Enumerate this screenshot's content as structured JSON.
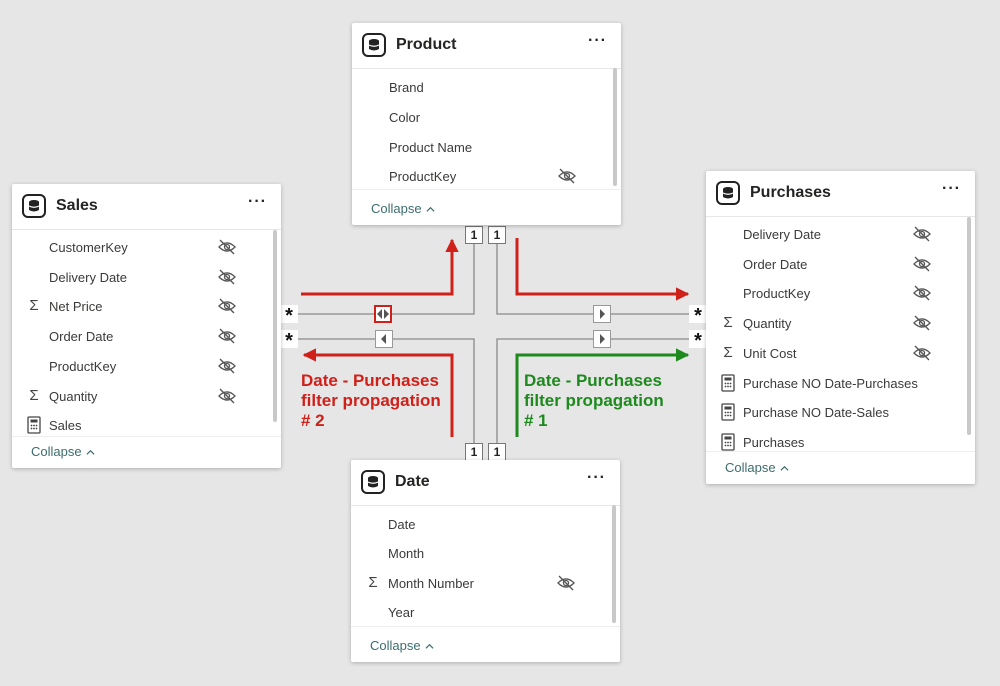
{
  "tables": {
    "product": {
      "title": "Product",
      "more": "···",
      "collapse": "Collapse",
      "fields": [
        "Brand",
        "Color",
        "Product Name",
        "ProductKey"
      ]
    },
    "sales": {
      "title": "Sales",
      "more": "···",
      "collapse": "Collapse",
      "fields": [
        "CustomerKey",
        "Delivery Date",
        "Net Price",
        "Order Date",
        "ProductKey",
        "Quantity",
        "Sales"
      ]
    },
    "purchases": {
      "title": "Purchases",
      "more": "···",
      "collapse": "Collapse",
      "fields": [
        "Delivery Date",
        "Order Date",
        "ProductKey",
        "Quantity",
        "Unit Cost",
        "Purchase NO Date-Purchases",
        "Purchase NO Date-Sales",
        "Purchases"
      ]
    },
    "date": {
      "title": "Date",
      "more": "···",
      "collapse": "Collapse",
      "fields": [
        "Date",
        "Month",
        "Month Number",
        "Year"
      ]
    }
  },
  "cardinality": {
    "one": "1",
    "many": "*"
  },
  "annotations": {
    "red": "Date - Purchases\nfilter propagation\n# 2",
    "green": "Date - Purchases\nfilter propagation\n# 1"
  },
  "colors": {
    "red": "#d0201a",
    "green": "#1e8a1e",
    "wire": "#8a8a8a",
    "collapse": "#3c6d6e"
  }
}
